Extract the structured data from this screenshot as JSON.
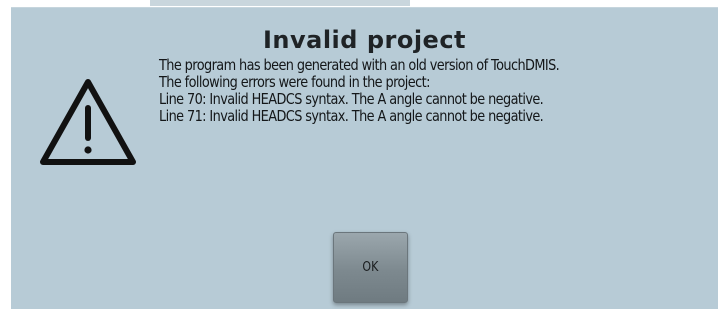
{
  "dialog": {
    "title": "Invalid project",
    "icon": "warning-triangle-icon",
    "message_lines": [
      "The program has been generated with an old version of TouchDMIS.",
      "The following errors were found in the project:",
      "Line 70: Invalid HEADCS syntax. The A angle cannot be negative.",
      "Line 71: Invalid HEADCS syntax. The A angle cannot be negative."
    ],
    "ok_label": "OK"
  },
  "colors": {
    "dialog_background": "#b7cbd6",
    "button_gray": "#8a959b",
    "text": "#141719"
  }
}
